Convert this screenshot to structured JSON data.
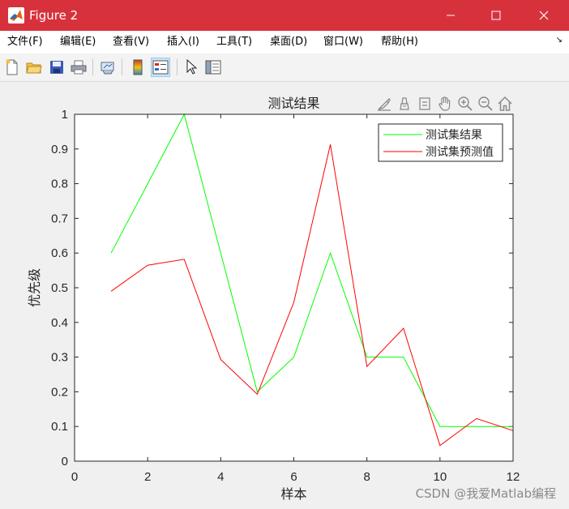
{
  "window": {
    "title": "Figure 2",
    "controls": [
      "minimize",
      "maximize",
      "close"
    ]
  },
  "menu": {
    "items": [
      {
        "label": "文件(F)"
      },
      {
        "label": "编辑(E)"
      },
      {
        "label": "查看(V)"
      },
      {
        "label": "插入(I)"
      },
      {
        "label": "工具(T)"
      },
      {
        "label": "桌面(D)"
      },
      {
        "label": "窗口(W)"
      },
      {
        "label": "帮助(H)"
      }
    ],
    "overflow_icon": "arrow-icon"
  },
  "toolbar": {
    "buttons": [
      "new-figure-icon",
      "open-file-icon",
      "save-icon",
      "print-icon",
      "link-plot-icon",
      "insert-colorbar-icon",
      "insert-legend-icon",
      "edit-plot-arrow-icon",
      "property-inspector-icon"
    ],
    "active_button": "insert-legend-icon"
  },
  "axes_toolbar": {
    "buttons": [
      "brush-icon",
      "data-tips-icon",
      "data-cursor-icon",
      "pan-icon",
      "zoom-in-icon",
      "zoom-out-icon",
      "restore-view-icon"
    ]
  },
  "chart_data": {
    "type": "line",
    "title": "测试结果",
    "xlabel": "样本",
    "ylabel": "优先级",
    "xlim": [
      0,
      12
    ],
    "ylim": [
      0,
      1
    ],
    "xticks": [
      0,
      2,
      4,
      6,
      8,
      10,
      12
    ],
    "yticks": [
      0,
      0.1,
      0.2,
      0.3,
      0.4,
      0.5,
      0.6,
      0.7,
      0.8,
      0.9,
      1
    ],
    "x": [
      1,
      2,
      3,
      4,
      5,
      6,
      7,
      8,
      9,
      10,
      11,
      12
    ],
    "series": [
      {
        "name": "测试集结果",
        "color": "#00ff00",
        "values": [
          0.6,
          0.8,
          1.0,
          0.6,
          0.2,
          0.3,
          0.6,
          0.3,
          0.3,
          0.1,
          0.1,
          0.1
        ]
      },
      {
        "name": "测试集预测值",
        "color": "#ff0000",
        "values": [
          0.49,
          0.565,
          0.582,
          0.293,
          0.193,
          0.458,
          0.913,
          0.273,
          0.383,
          0.045,
          0.123,
          0.088
        ]
      }
    ],
    "grid": false,
    "legend_position": "top-right"
  },
  "watermark": "CSDN @我爱Matlab编程"
}
